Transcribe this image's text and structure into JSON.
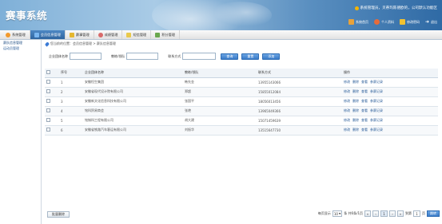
{
  "app": {
    "title": "赛事系统"
  },
  "header": {
    "welcome": "系统管理员，贝蒂玛陈德欧的，公司默认功能区",
    "links": [
      {
        "label": "系统首页",
        "icon": "home-icon",
        "color": "#e8a23a"
      },
      {
        "label": "个人资料",
        "icon": "user-icon",
        "color": "#e56b3b"
      },
      {
        "label": "修改密码",
        "icon": "lock-icon",
        "color": "#f2c230"
      },
      {
        "label": "退出",
        "icon": "logout-icon",
        "color": "#ffffff"
      }
    ]
  },
  "nav": {
    "tabs": [
      {
        "label": "系统管理",
        "icon": "gear-icon",
        "color": "#f29a2e"
      },
      {
        "label": "会员信息管理",
        "icon": "users-icon",
        "color": "#7ab6f0",
        "active": true
      },
      {
        "label": "赛事管理",
        "icon": "trophy-icon",
        "color": "#e5b72f"
      },
      {
        "label": "成绩管理",
        "icon": "chart-icon",
        "color": "#d86b6b"
      },
      {
        "label": "短信管理",
        "icon": "message-icon",
        "color": "#e9c94c"
      },
      {
        "label": "积分管理",
        "icon": "bar-chart-icon",
        "color": "#6aa84f"
      }
    ]
  },
  "sidebar": {
    "items": [
      {
        "label": "赛队信息管理"
      },
      {
        "label": "运动员管理"
      }
    ]
  },
  "breadcrumb": "您当前的位置：会员信息管理 > 赛队信息管理",
  "filters": {
    "company_label": "企业团体名称",
    "coach_label": "教练/领队",
    "contact_label": "联系方式",
    "search_label": "查询",
    "reset_label": "重置",
    "add_label": "添加"
  },
  "table": {
    "headers": [
      "序号",
      "企业团体名称",
      "教练/领队",
      "联系方式",
      "操作"
    ],
    "rows": [
      {
        "no": "1",
        "company": "安徽恒生集团",
        "coach": "韩先金",
        "contact": "13955143066"
      },
      {
        "no": "2",
        "company": "安徽省现代设计院有限公司",
        "coach": "郑超",
        "contact": "15855012084"
      },
      {
        "no": "3",
        "company": "安徽新文化信息科技有限公司",
        "coach": "张国平",
        "contact": "18056013456"
      },
      {
        "no": "4",
        "company": "铭科贸易商会",
        "coach": "张艳",
        "contact": "13965049366"
      },
      {
        "no": "5",
        "company": "铭铖科工程有限公司",
        "coach": "胡大建",
        "contact": "15071459639"
      },
      {
        "no": "6",
        "company": "安徽省铁路汽车客运有限公司",
        "coach": "刘振华",
        "contact": "13515647730"
      }
    ],
    "ops": [
      "修改",
      "删除",
      "查看",
      "参赛记录"
    ]
  },
  "footer": {
    "bulk_delete": "批量删除",
    "per_page_label": "每页显示",
    "per_page": "10",
    "total_text": "条  共6条/1页",
    "page_current": "1",
    "jump_label": "到第",
    "jump_value": "1",
    "page_unit": "页",
    "go_label": "跳转"
  }
}
